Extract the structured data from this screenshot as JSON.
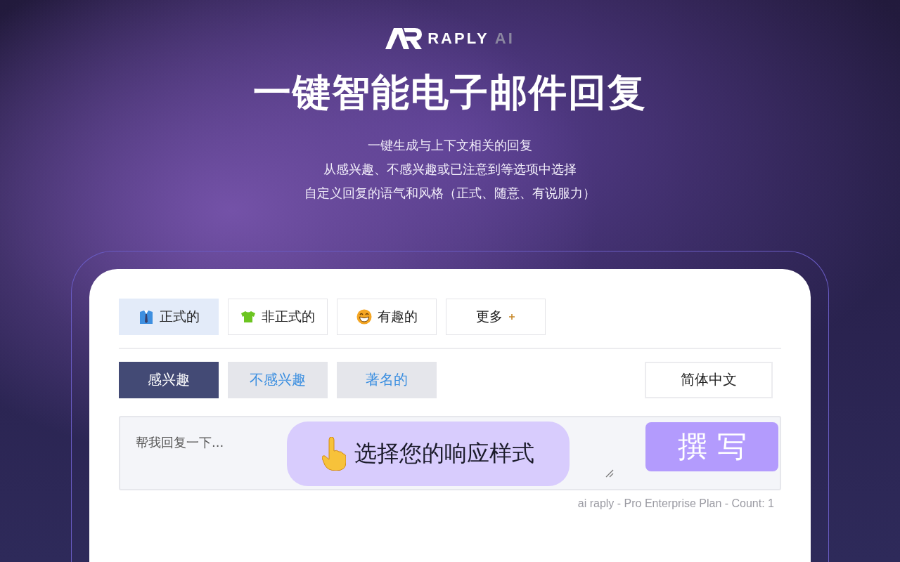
{
  "logo": {
    "name": "RAPLY",
    "suffix": "AI"
  },
  "headline": "一键智能电子邮件回复",
  "features": [
    "一键生成与上下文相关的回复",
    "从感兴趣、不感兴趣或已注意到等选项中选择",
    "自定义回复的语气和风格（正式、随意、有说服力）"
  ],
  "tones": [
    {
      "label": "正式的",
      "kind": "formal",
      "selected": true
    },
    {
      "label": "非正式的",
      "kind": "casual",
      "selected": false
    },
    {
      "label": "有趣的",
      "kind": "funny",
      "selected": false
    },
    {
      "label": "更多",
      "kind": "more",
      "selected": false
    }
  ],
  "intents": [
    {
      "label": "感兴趣",
      "selected": true
    },
    {
      "label": "不感兴趣",
      "selected": false
    },
    {
      "label": "著名的",
      "selected": false
    }
  ],
  "language": "简体中文",
  "reply_box": {
    "placeholder": "帮我回复一下..."
  },
  "tooltip": "选择您的响应样式",
  "compose_button": "撰写",
  "footer": "ai raply - Pro Enterprise Plan - Count: 1"
}
